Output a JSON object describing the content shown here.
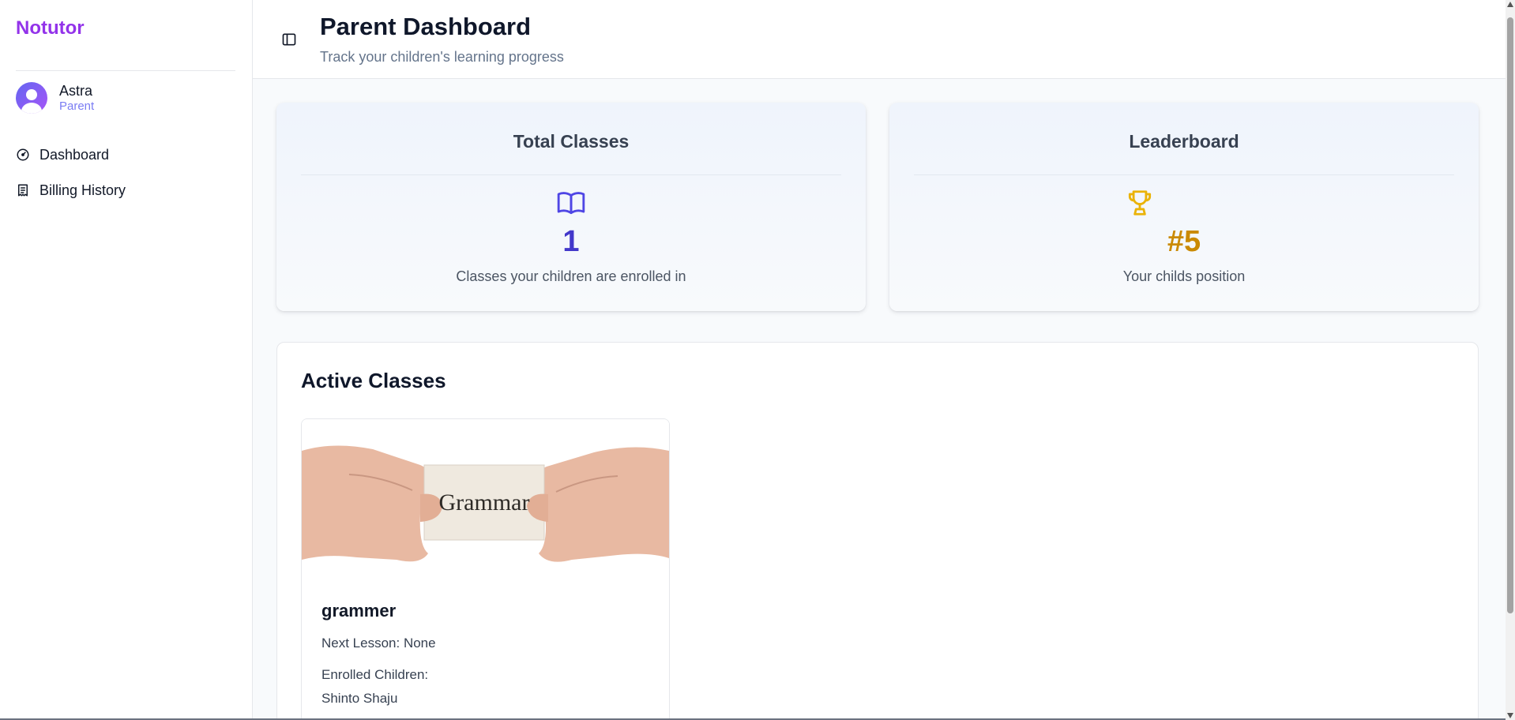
{
  "sidebar": {
    "brand": "Notutor",
    "brand_color": "#9333ea",
    "user": {
      "name": "Astra",
      "role": "Parent",
      "avatar_icon": "user-avatar-icon"
    },
    "nav": [
      {
        "label": "Dashboard",
        "icon": "dashboard-gauge-icon"
      },
      {
        "label": "Billing History",
        "icon": "receipt-icon"
      }
    ]
  },
  "header": {
    "toggle_icon": "sidebar-toggle-icon",
    "title": "Parent Dashboard",
    "subtitle": "Track your children's learning progress"
  },
  "stats": {
    "total_classes": {
      "title": "Total Classes",
      "icon": "book-open-icon",
      "value": "1",
      "description": "Classes your children are enrolled in",
      "color": "#4338ca"
    },
    "leaderboard": {
      "title": "Leaderboard",
      "icon": "trophy-icon",
      "value": "#5",
      "description": "Your childs position",
      "color": "#ca8a04"
    }
  },
  "active_classes": {
    "title": "Active Classes",
    "classes": [
      {
        "image_text": "Grammar",
        "name": "grammer",
        "next_lesson": "Next Lesson: None",
        "enrolled_label": "Enrolled Children:",
        "enrolled_children": "Shinto Shaju"
      }
    ]
  }
}
